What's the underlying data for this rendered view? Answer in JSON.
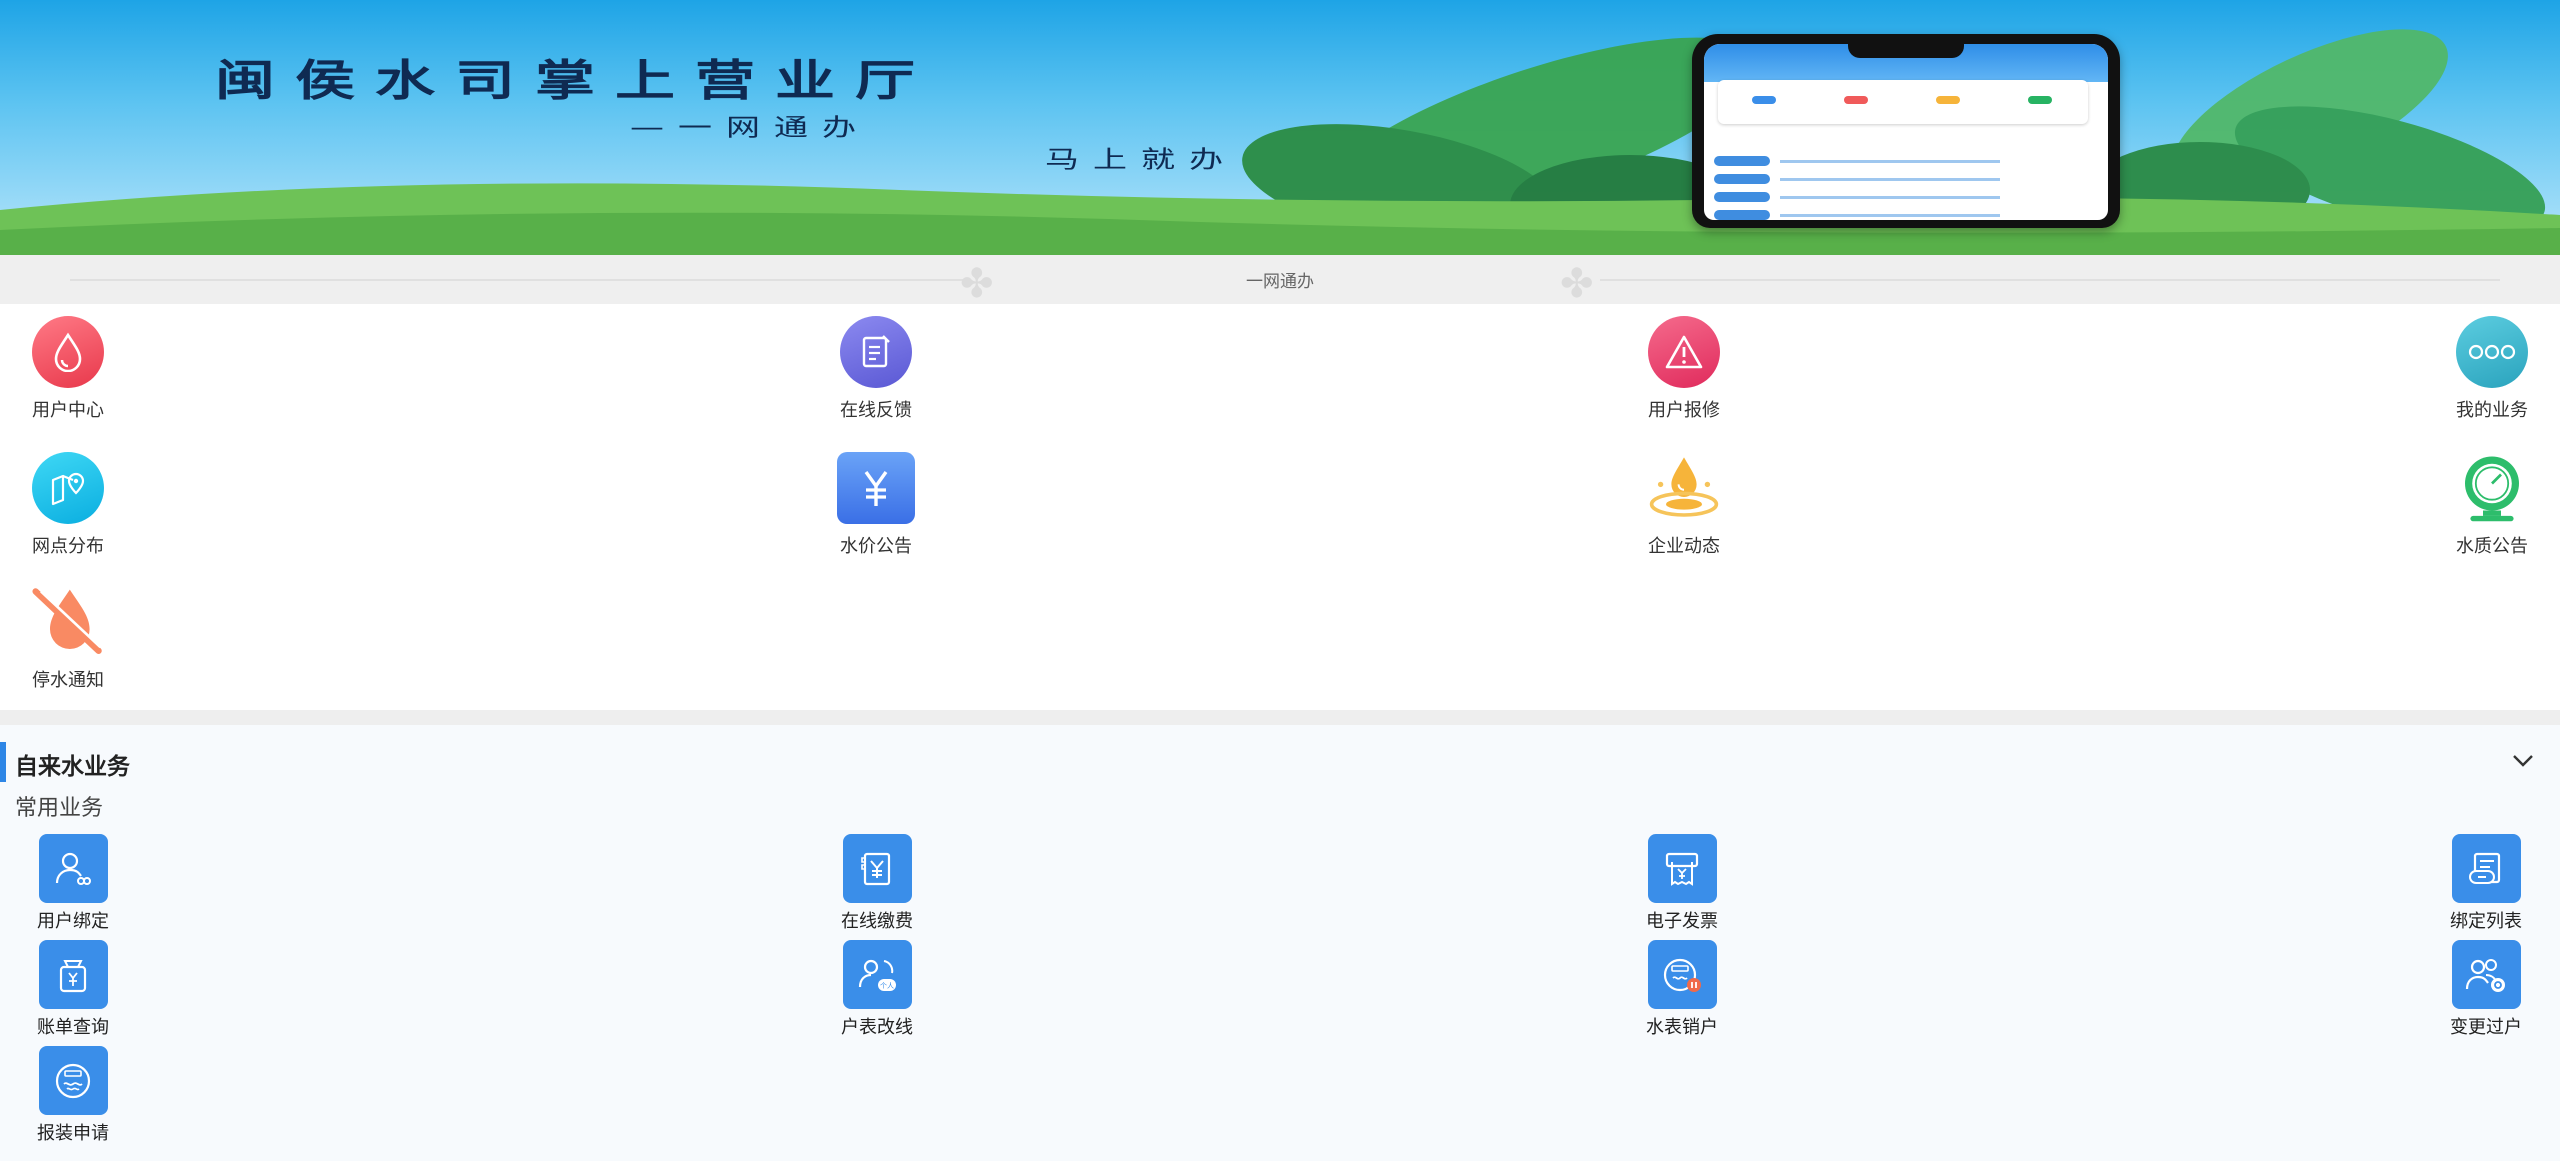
{
  "banner": {
    "title": "闽侯水司掌上营业厅",
    "subtitle_1": "一网通办",
    "subtitle_2": "马上就办"
  },
  "divider": {
    "label": "一网通办"
  },
  "quick_services": [
    {
      "label": "用户中心",
      "icon": "water-drop-icon",
      "color": "#f0505e"
    },
    {
      "label": "在线反馈",
      "icon": "document-edit-icon",
      "color": "#6f6ee0"
    },
    {
      "label": "用户报修",
      "icon": "warning-icon",
      "color": "#ec3f6f"
    },
    {
      "label": "我的业务",
      "icon": "more-dots-icon",
      "color": "#32b1c9"
    },
    {
      "label": "网点分布",
      "icon": "map-pin-icon",
      "color": "#12b8ea"
    },
    {
      "label": "水价公告",
      "icon": "price-board-icon",
      "color": "#4f84f0"
    },
    {
      "label": "企业动态",
      "icon": "water-splash-icon",
      "color": "#f6b43a"
    },
    {
      "label": "水质公告",
      "icon": "water-meter-icon",
      "color": "#27b363"
    },
    {
      "label": "停水通知",
      "icon": "water-off-icon",
      "color": "#f77e57"
    }
  ],
  "business": {
    "section_title": "自来水业务",
    "group_title": "常用业务",
    "items": [
      {
        "label": "用户绑定",
        "icon": "user-link-icon"
      },
      {
        "label": "在线缴费",
        "icon": "payment-receipt-icon"
      },
      {
        "label": "电子发票",
        "icon": "invoice-printer-icon"
      },
      {
        "label": "绑定列表",
        "icon": "bound-list-icon"
      },
      {
        "label": "账单查询",
        "icon": "bill-bag-icon"
      },
      {
        "label": "户表改线",
        "icon": "meter-reroute-icon"
      },
      {
        "label": "水表销户",
        "icon": "meter-cancel-icon"
      },
      {
        "label": "变更过户",
        "icon": "transfer-owner-icon"
      },
      {
        "label": "报装申请",
        "icon": "install-apply-icon"
      }
    ],
    "accent": "#2e86e6"
  }
}
